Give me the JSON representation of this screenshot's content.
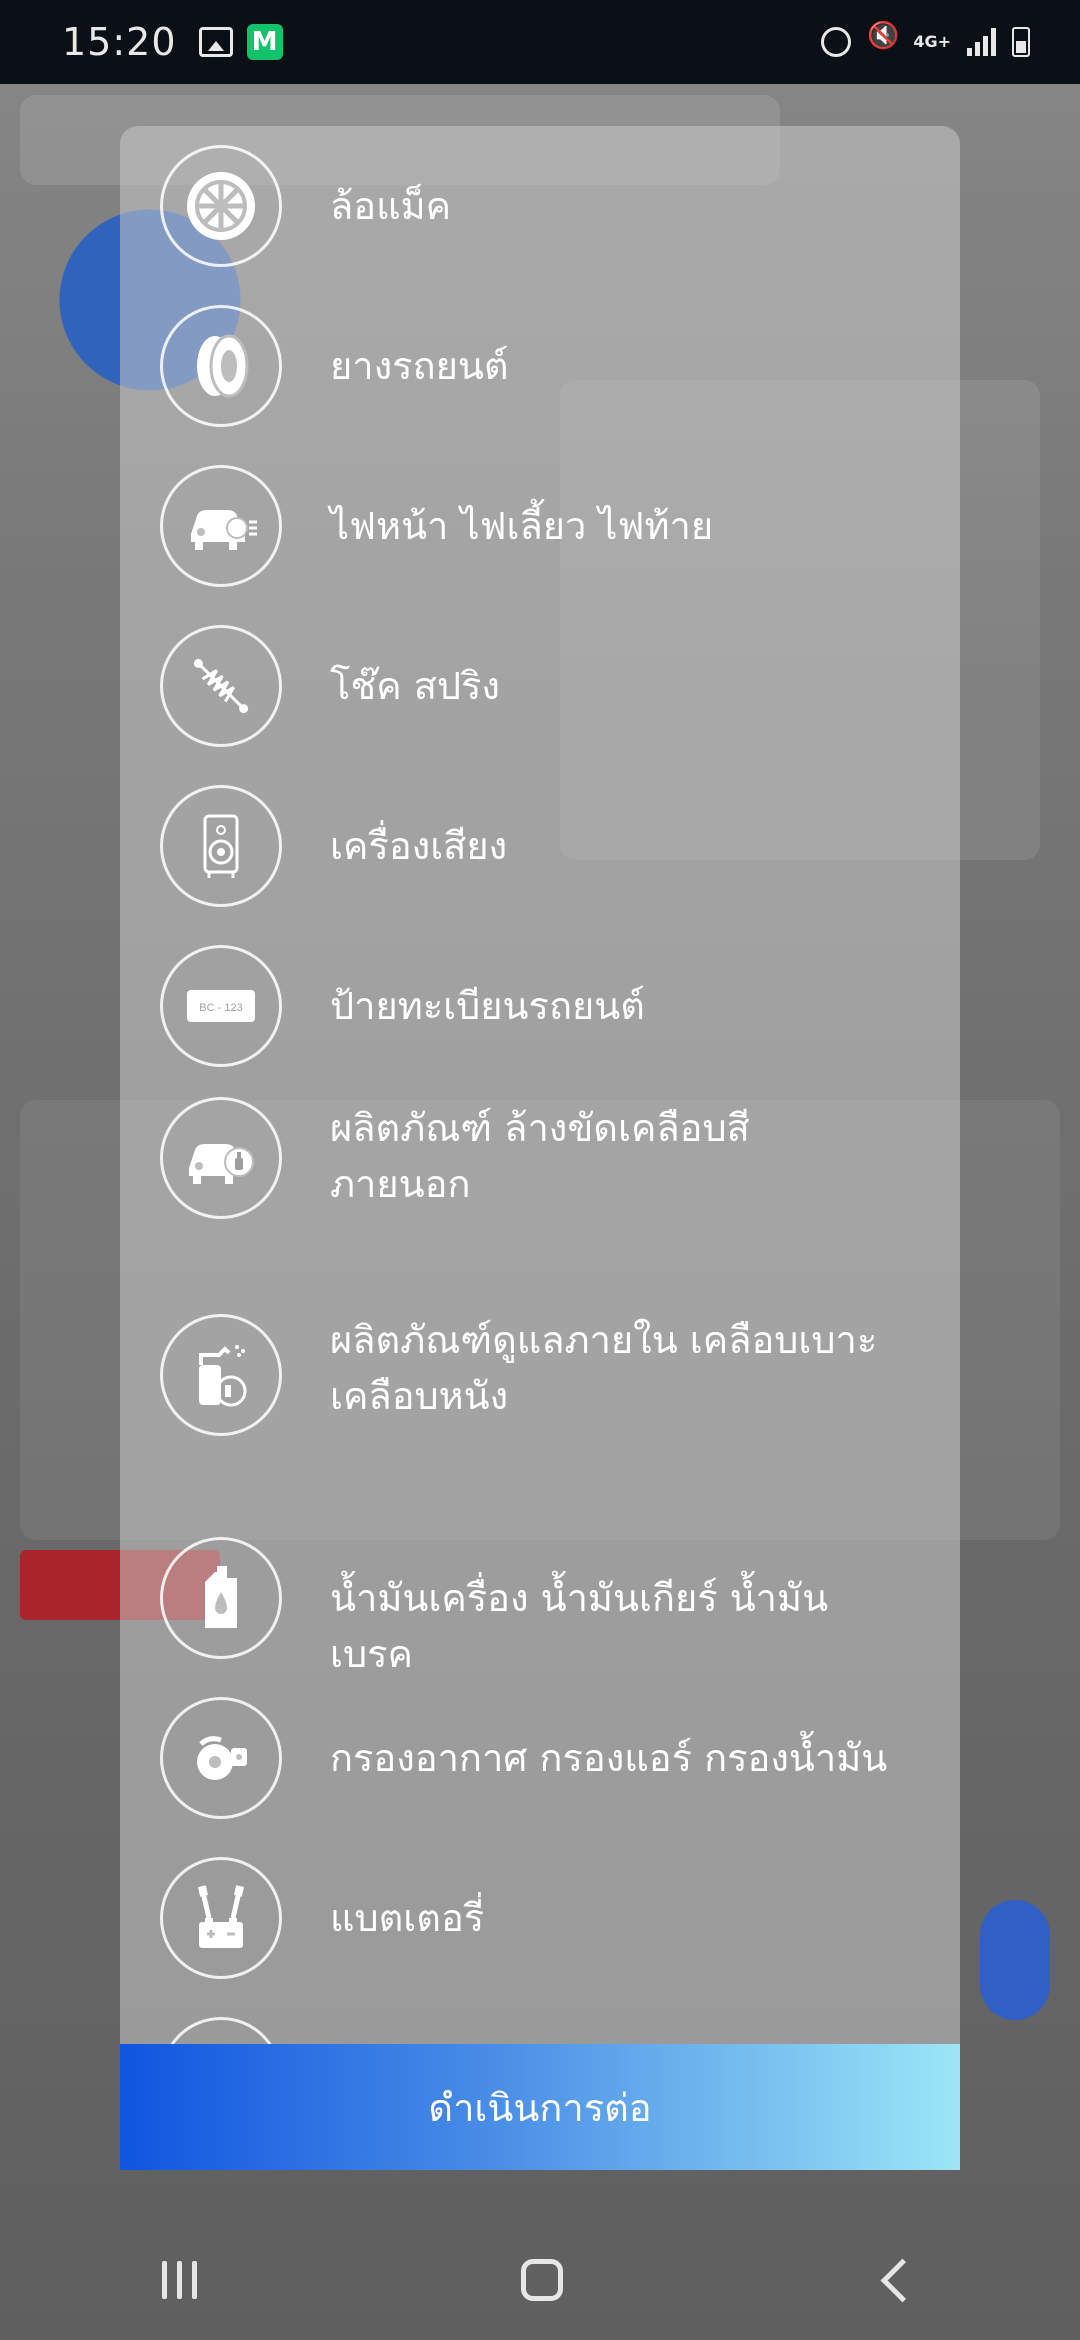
{
  "status_bar": {
    "time": "15:20",
    "network": "4G+"
  },
  "categories": [
    {
      "label": "ล้อแม็ค",
      "icon": "wheel-icon"
    },
    {
      "label": "ยางรถยนต์",
      "icon": "tire-icon"
    },
    {
      "label": "ไฟหน้า ไฟเลี้ยว ไฟท้าย",
      "icon": "headlight-car-icon"
    },
    {
      "label": "โช๊ค สปริง",
      "icon": "shock-absorber-icon"
    },
    {
      "label": "เครื่องเสียง",
      "icon": "speaker-icon"
    },
    {
      "label": "ป้ายทะเบียนรถยนต์",
      "icon": "license-plate-icon",
      "plate_text": "BC - 123"
    },
    {
      "label": "ผลิตภัณฑ์ ล้างขัดเคลือบสี ภายนอก",
      "icon": "car-wash-product-icon"
    },
    {
      "label": "ผลิตภัณฑ์ดูแลภายใน เคลือบเบาะ เคลือบหนัง",
      "icon": "interior-spray-icon"
    },
    {
      "label": "น้ำมันเครื่อง น้ำมันเกียร์ น้ำมันเบรค",
      "icon": "oil-bottle-icon"
    },
    {
      "label": "กรองอากาศ กรองแอร์ กรองน้ำมัน",
      "icon": "air-filter-icon"
    },
    {
      "label": "แบตเตอรี่",
      "icon": "battery-jumper-icon"
    }
  ],
  "continue_button": {
    "label": "ดำเนินการต่อ"
  },
  "colors": {
    "button_gradient_start": "#1055e0",
    "button_gradient_end": "#9ce6f7",
    "status_bar": "#0b0f16"
  }
}
